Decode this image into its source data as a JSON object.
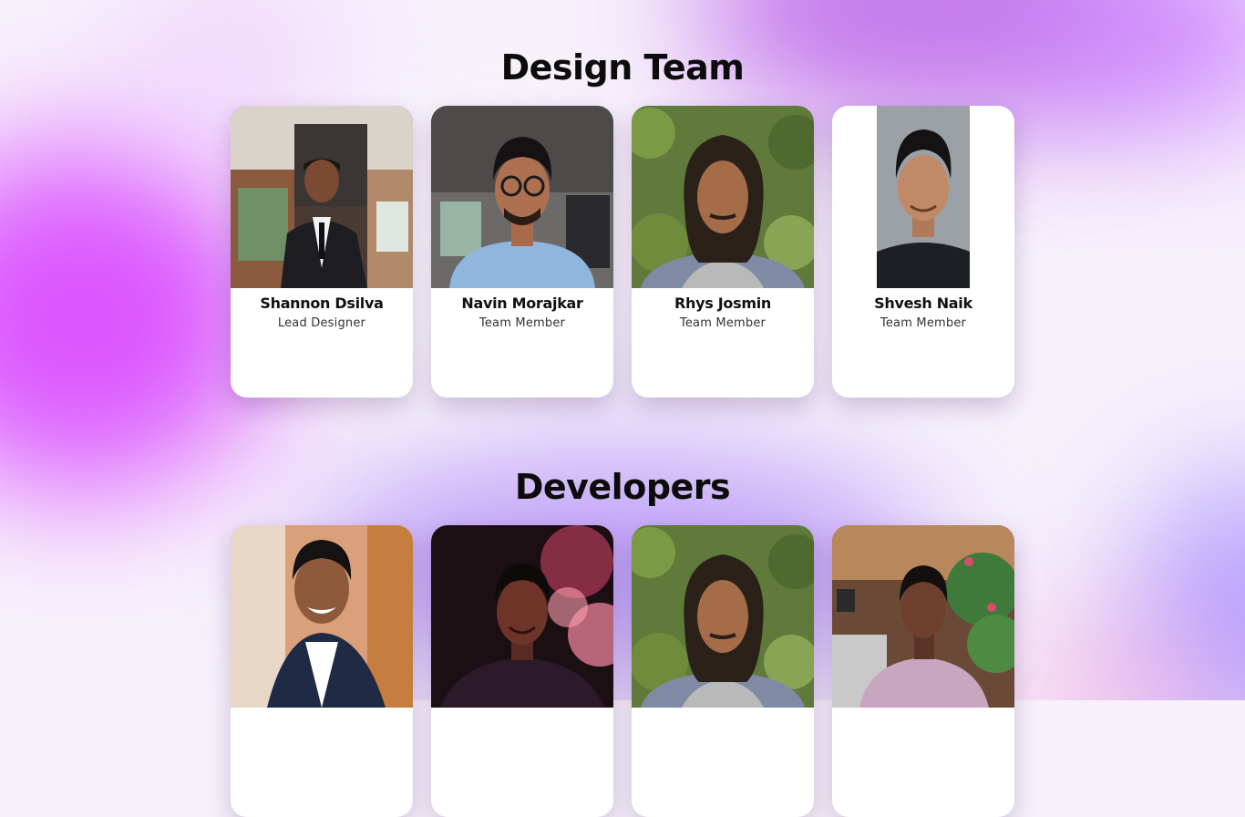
{
  "sections": [
    {
      "title": "Design Team",
      "members": [
        {
          "name": "Shannon Dsilva",
          "role": "Lead Designer"
        },
        {
          "name": "Navin Morajkar",
          "role": "Team Member"
        },
        {
          "name": "Rhys Josmin",
          "role": "Team Member"
        },
        {
          "name": "Shvesh Naik",
          "role": "Team Member"
        }
      ]
    },
    {
      "title": "Developers",
      "members": [
        {
          "name": "",
          "role": ""
        },
        {
          "name": "",
          "role": ""
        },
        {
          "name": "",
          "role": ""
        },
        {
          "name": "",
          "role": ""
        }
      ]
    }
  ],
  "colors": {
    "accent_magenta": "#d63cff",
    "accent_purple": "#8e5cf5",
    "card_bg": "#ffffff",
    "title_text": "#0c0c0c"
  }
}
